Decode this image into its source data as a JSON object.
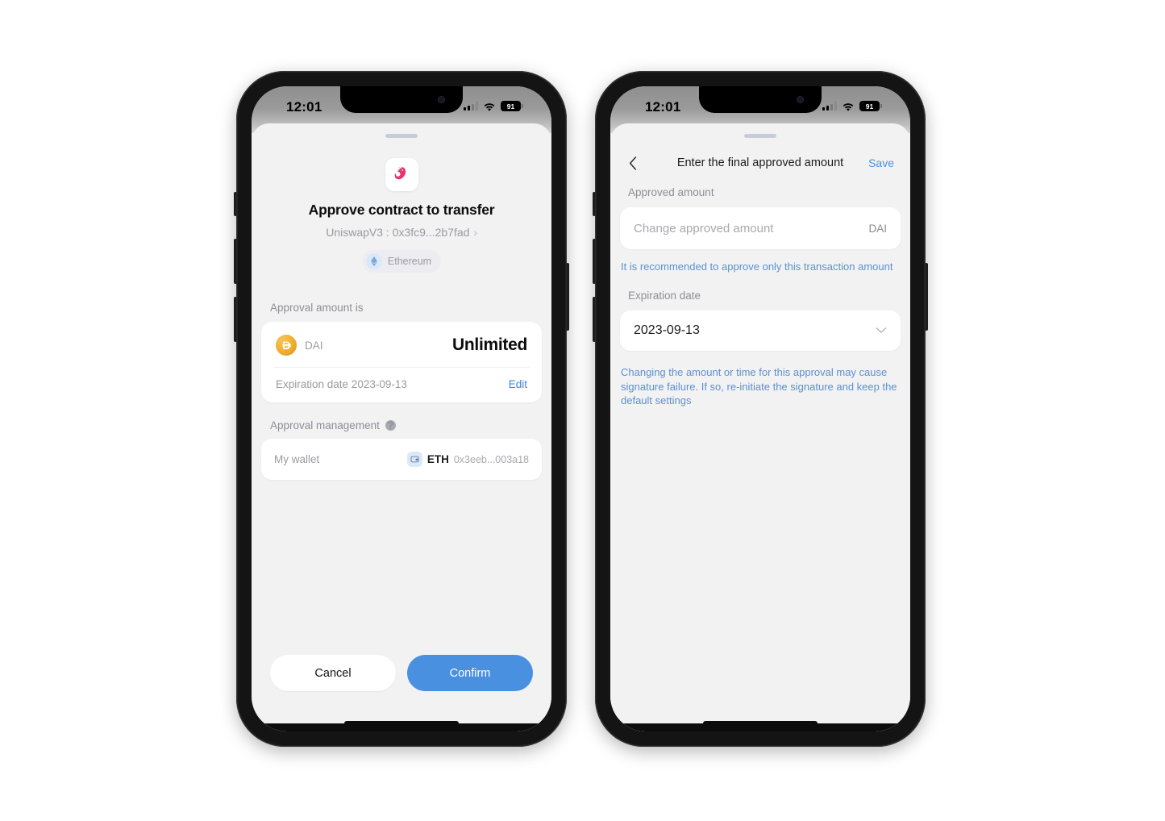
{
  "statusbar": {
    "time": "12:01",
    "battery": "91",
    "icons": [
      "cellular-signal-icon",
      "wifi-icon",
      "battery-icon"
    ]
  },
  "phone_one": {
    "dapp_logo": "uniswap-logo-icon",
    "title": "Approve contract to transfer",
    "contract": "UniswapV3 : 0x3fc9...2b7fad",
    "chevron": "›",
    "network": {
      "icon": "ethereum-icon",
      "name": "Ethereum"
    },
    "approval_label": "Approval amount is",
    "token": {
      "icon": "dai-coin-icon",
      "symbol": "DAI",
      "amount": "Unlimited"
    },
    "expiration": {
      "text": "Expiration date 2023-09-13",
      "edit_label": "Edit"
    },
    "management_label": "Approval management",
    "help_icon": "help-circle-icon",
    "wallet": {
      "label": "My wallet",
      "icon": "wallet-icon",
      "symbol": "ETH",
      "address": "0x3eeb...003a18"
    },
    "buttons": {
      "cancel": "Cancel",
      "confirm": "Confirm"
    }
  },
  "phone_two": {
    "back_icon": "chevron-left-icon",
    "title": "Enter the final approved amount",
    "save_label": "Save",
    "approved_amount_label": "Approved amount",
    "amount_input": {
      "placeholder": "Change approved amount",
      "value": "",
      "unit": "DAI"
    },
    "recommend_hint": "It is recommended to approve only this transaction amount",
    "expiration_label": "Expiration date",
    "expiration_value": "2023-09-13",
    "chevron_icon": "chevron-down-icon",
    "warning": "Changing the amount or time for this approval may cause signature failure. If so, re-initiate the signature and keep the default settings"
  },
  "colors": {
    "accent_blue": "#4a90e0",
    "hint_blue": "#5c90d2",
    "sheet_bg": "#f2f2f3",
    "dai_gold": "#eead30"
  }
}
